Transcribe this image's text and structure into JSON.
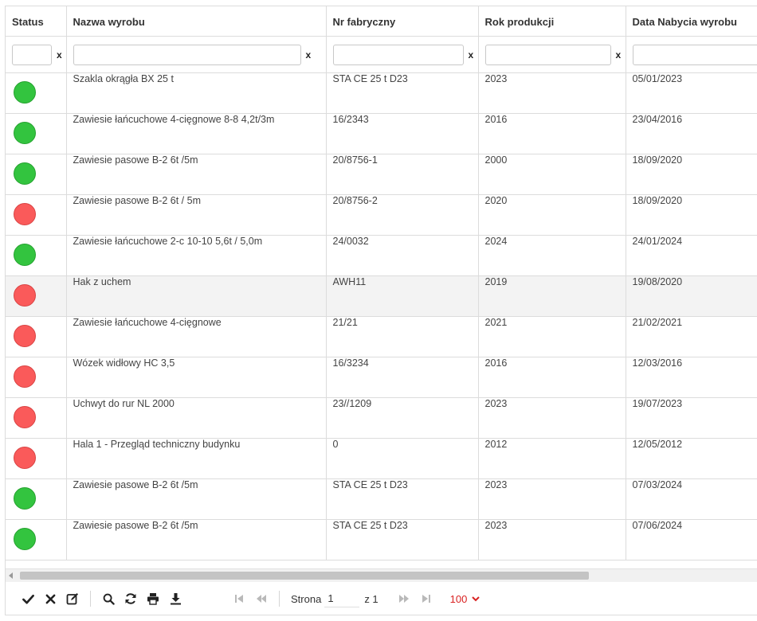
{
  "columns": {
    "status": "Status",
    "name": "Nazwa wyrobu",
    "serial": "Nr fabryczny",
    "year": "Rok produkcji",
    "date": "Data Nabycia wyrobu"
  },
  "filters": {
    "clear_label": "x",
    "status_value": "",
    "name_value": "",
    "serial_value": "",
    "year_value": "",
    "date_value": ""
  },
  "colors": {
    "status_ok": "#33c43f",
    "status_bad": "#fa5a5a",
    "page_size_accent": "#d92222"
  },
  "rows": [
    {
      "status": "ok",
      "name": "Szakla okrągła BX 25 t",
      "serial": "STA CE 25 t D23",
      "year": "2023",
      "date": "05/01/2023"
    },
    {
      "status": "ok",
      "name": "Zawiesie łańcuchowe 4-cięgnowe 8-8 4,2t/3m",
      "serial": "16/2343",
      "year": "2016",
      "date": "23/04/2016"
    },
    {
      "status": "ok",
      "name": "Zawiesie pasowe B-2 6t /5m",
      "serial": "20/8756-1",
      "year": "2000",
      "date": "18/09/2020"
    },
    {
      "status": "bad",
      "name": "Zawiesie pasowe B-2 6t / 5m",
      "serial": "20/8756-2",
      "year": "2020",
      "date": "18/09/2020"
    },
    {
      "status": "ok",
      "name": "Zawiesie łańcuchowe 2-c 10-10 5,6t / 5,0m",
      "serial": "24/0032",
      "year": "2024",
      "date": "24/01/2024"
    },
    {
      "status": "bad",
      "name": "Hak z uchem",
      "serial": "AWH11",
      "year": "2019",
      "date": "19/08/2020",
      "highlight": true
    },
    {
      "status": "bad",
      "name": "Zawiesie łańcuchowe 4-cięgnowe",
      "serial": "21/21",
      "year": "2021",
      "date": "21/02/2021"
    },
    {
      "status": "bad",
      "name": "Wózek widłowy HC 3,5",
      "serial": "16/3234",
      "year": "2016",
      "date": "12/03/2016"
    },
    {
      "status": "bad",
      "name": "Uchwyt do rur NL 2000",
      "serial": "23//1209",
      "year": "2023",
      "date": "19/07/2023"
    },
    {
      "status": "bad",
      "name": "Hala 1 - Przegląd techniczny budynku",
      "serial": "0",
      "year": "2012",
      "date": "12/05/2012"
    },
    {
      "status": "ok",
      "name": "Zawiesie pasowe B-2 6t /5m",
      "serial": "STA CE 25 t D23",
      "year": "2023",
      "date": "07/03/2024"
    },
    {
      "status": "ok",
      "name": "Zawiesie pasowe B-2 6t /5m",
      "serial": "STA CE 25 t D23",
      "year": "2023",
      "date": "07/06/2024"
    }
  ],
  "toolbar": {
    "icons": [
      "check-icon",
      "close-icon",
      "edit-icon",
      "search-icon",
      "refresh-icon",
      "print-icon",
      "download-icon"
    ]
  },
  "pager": {
    "page_label": "Strona",
    "page_value": "1",
    "of_label": "z 1",
    "page_size": "100",
    "nav_icons": [
      "first-page-icon",
      "prev-page-icon",
      "next-page-icon",
      "last-page-icon"
    ]
  }
}
